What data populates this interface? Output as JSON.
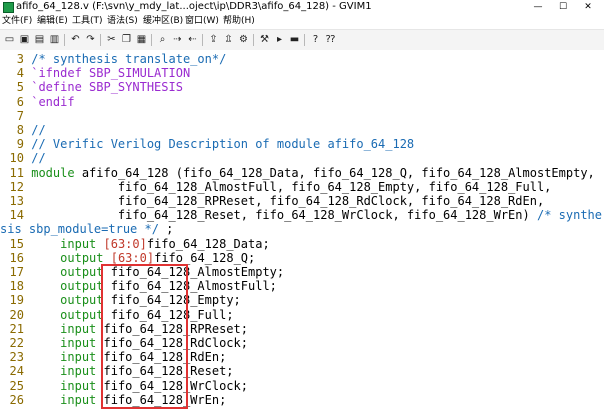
{
  "window": {
    "title": "afifo_64_128.v (F:\\svn\\y_mdy_lat...oject\\ip\\DDR3\\afifo_64_128) - GVIM1",
    "min_glyph": "—",
    "max_glyph": "☐",
    "close_glyph": "✕"
  },
  "menu": [
    "文件(F)",
    "编辑(E)",
    "工具(T)",
    "语法(S)",
    "缓冲区(B)",
    "窗口(W)",
    "帮助(H)"
  ],
  "toolbar": {
    "icons": [
      "open-icon",
      "save-icon",
      "save-all-icon",
      "print-icon",
      "undo-icon",
      "redo-icon",
      "cut-icon",
      "copy-icon",
      "paste-icon",
      "find-icon",
      "find-next-icon",
      "find-prev-icon",
      "load-session-icon",
      "save-session-icon",
      "run-script-icon",
      "make-icon",
      "shell-icon",
      "tag-jump-icon",
      "help-icon",
      "find-help-icon"
    ]
  },
  "colors": {
    "comment": "#1a6bb3",
    "preprocessor": "#9a2bd0",
    "keyword": "#1a8f1a",
    "number": "#c0392b",
    "line_number": "#8a6a00",
    "highlight_box": "#e03232"
  },
  "editor": {
    "lines": [
      {
        "n": "3",
        "seg": [
          [
            "c",
            "/* synthesis translate_on*/"
          ]
        ]
      },
      {
        "n": "4",
        "seg": [
          [
            "pp",
            "`ifndef SBP_SIMULATION"
          ]
        ]
      },
      {
        "n": "5",
        "seg": [
          [
            "pp",
            "`define SBP_SYNTHESIS"
          ]
        ]
      },
      {
        "n": "6",
        "seg": [
          [
            "pp",
            "`endif"
          ]
        ]
      },
      {
        "n": "7",
        "seg": []
      },
      {
        "n": "8",
        "seg": [
          [
            "c",
            "//"
          ]
        ]
      },
      {
        "n": "9",
        "seg": [
          [
            "c",
            "// Verific Verilog Description of module afifo_64_128"
          ]
        ]
      },
      {
        "n": "10",
        "seg": [
          [
            "c",
            "//"
          ]
        ]
      },
      {
        "n": "11",
        "seg": [
          [
            "kw",
            "module"
          ],
          [
            "id",
            " afifo_64_128 (fifo_64_128_Data, fifo_64_128_Q, fifo_64_128_AlmostEmpty,"
          ]
        ]
      },
      {
        "n": "12",
        "seg": [
          [
            "id",
            "            fifo_64_128_AlmostFull, fifo_64_128_Empty, fifo_64_128_Full,"
          ]
        ]
      },
      {
        "n": "13",
        "seg": [
          [
            "id",
            "            fifo_64_128_RPReset, fifo_64_128_RdClock, fifo_64_128_RdEn,"
          ]
        ]
      },
      {
        "n": "14",
        "seg": [
          [
            "id",
            "            fifo_64_128_Reset, fifo_64_128_WrClock, fifo_64_128_WrEn) "
          ],
          [
            "c",
            "/* synthe"
          ]
        ]
      },
      {
        "n": "",
        "seg": [
          [
            "c",
            "sis sbp_module=true */ "
          ],
          [
            "id",
            ";"
          ]
        ]
      },
      {
        "n": "15",
        "seg": [
          [
            "id",
            "    "
          ],
          [
            "kw",
            "input"
          ],
          [
            "id",
            " "
          ],
          [
            "num",
            "[63:0]"
          ],
          [
            "id",
            "fifo_64_128_Data;"
          ]
        ]
      },
      {
        "n": "16",
        "seg": [
          [
            "id",
            "    "
          ],
          [
            "kw",
            "output"
          ],
          [
            "id",
            " "
          ],
          [
            "num",
            "[63:0]"
          ],
          [
            "id",
            "fifo_64_128_Q;"
          ]
        ]
      },
      {
        "n": "17",
        "seg": [
          [
            "id",
            "    "
          ],
          [
            "kw",
            "output"
          ],
          [
            "id",
            " fifo_64_128_AlmostEmpty;"
          ]
        ]
      },
      {
        "n": "18",
        "seg": [
          [
            "id",
            "    "
          ],
          [
            "kw",
            "output"
          ],
          [
            "id",
            " fifo_64_128_AlmostFull;"
          ]
        ]
      },
      {
        "n": "19",
        "seg": [
          [
            "id",
            "    "
          ],
          [
            "kw",
            "output"
          ],
          [
            "id",
            " fifo_64_128_Empty;"
          ]
        ]
      },
      {
        "n": "20",
        "seg": [
          [
            "id",
            "    "
          ],
          [
            "kw",
            "output"
          ],
          [
            "id",
            " fifo_64_128_Full;"
          ]
        ]
      },
      {
        "n": "21",
        "seg": [
          [
            "id",
            "    "
          ],
          [
            "kw",
            "input"
          ],
          [
            "id",
            " fifo_64_128_RPReset;"
          ]
        ]
      },
      {
        "n": "22",
        "seg": [
          [
            "id",
            "    "
          ],
          [
            "kw",
            "input"
          ],
          [
            "id",
            " fifo_64_128_RdClock;"
          ]
        ]
      },
      {
        "n": "23",
        "seg": [
          [
            "id",
            "    "
          ],
          [
            "kw",
            "input"
          ],
          [
            "id",
            " fifo_64_128_RdEn;"
          ]
        ]
      },
      {
        "n": "24",
        "seg": [
          [
            "id",
            "    "
          ],
          [
            "kw",
            "input"
          ],
          [
            "id",
            " fifo_64_128_Reset;"
          ]
        ]
      },
      {
        "n": "25",
        "seg": [
          [
            "id",
            "    "
          ],
          [
            "kw",
            "input"
          ],
          [
            "id",
            " fifo_64_128_WrClock;"
          ]
        ]
      },
      {
        "n": "26",
        "seg": [
          [
            "id",
            "    "
          ],
          [
            "kw",
            "input"
          ],
          [
            "id",
            " fifo_64_128_WrEn;"
          ]
        ]
      }
    ]
  }
}
